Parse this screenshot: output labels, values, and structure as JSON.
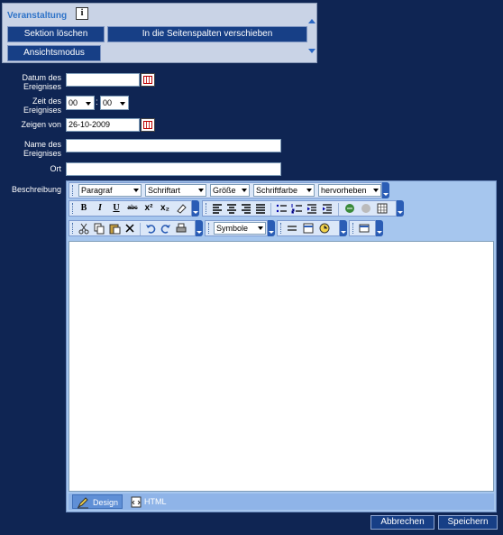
{
  "panel": {
    "title": "Veranstaltung",
    "info_icon": "i",
    "buttons": {
      "delete": "Sektion löschen",
      "move": "In die Seitenspalten verschieben",
      "view": "Ansichtsmodus"
    }
  },
  "form": {
    "date_label": "Datum des Ereignises",
    "date_value": "",
    "time_label": "Zeit des Ereignises",
    "time_hour": "00",
    "time_sep": ":",
    "time_minute": "00",
    "show_label": "Zeigen von",
    "show_value": "26-10-2009",
    "name_label": "Name des Ereignises",
    "name_value": "",
    "place_label": "Ort",
    "place_value": "",
    "desc_label": "Beschreibung"
  },
  "editor": {
    "row1": {
      "paragraph": "Paragraf",
      "font": "Schriftart",
      "size": "Größe",
      "color": "Schriftfarbe",
      "highlight": "hervorheben"
    },
    "row2_icons": [
      "bold-icon",
      "italic-icon",
      "underline-icon",
      "strikethrough-icon",
      "superscript-icon",
      "subscript-icon",
      "eraser-icon",
      "align-left-icon",
      "align-center-icon",
      "align-right-icon",
      "justify-icon",
      "bullet-list-icon",
      "numbered-list-icon",
      "outdent-icon",
      "indent-icon",
      "link-icon",
      "unlink-icon",
      "table-icon"
    ],
    "row2_glyphs": {
      "bold": "B",
      "italic": "I",
      "underline": "U",
      "strike": "abc",
      "sup": "x²",
      "sub": "x₂"
    },
    "row3": {
      "symbols": "Symbole"
    },
    "tabs": {
      "design": "Design",
      "html": "HTML"
    }
  },
  "footer": {
    "cancel": "Abbrechen",
    "save": "Speichern"
  },
  "colors": {
    "background": "#0f2553",
    "panel": "#c9d3e6",
    "button": "#173f86",
    "accent": "#2f73c8"
  }
}
